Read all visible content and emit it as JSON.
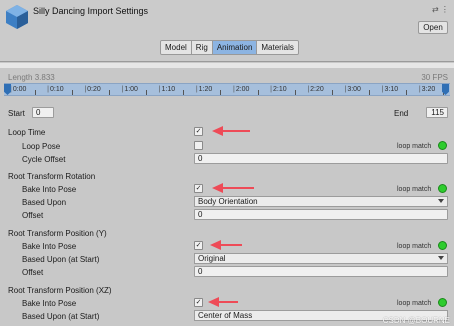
{
  "header": {
    "title": "Silly Dancing Import Settings",
    "icons": "⇄ ⋮",
    "open_label": "Open",
    "tabs": [
      "Model",
      "Rig",
      "Animation",
      "Materials"
    ],
    "active_tab": "Animation"
  },
  "timeline": {
    "length_label": "Length",
    "length_value": "3.833",
    "fps": "30 FPS",
    "ticks": [
      "0:00",
      "0:10",
      "0:20",
      "1:00",
      "1:10",
      "1:20",
      "2:00",
      "2:10",
      "2:20",
      "3:00",
      "3:10",
      "3:20"
    ]
  },
  "range": {
    "start_label": "Start",
    "start_value": "0",
    "end_label": "End",
    "end_value": "115"
  },
  "loop": {
    "loop_time_label": "Loop Time",
    "loop_time_checked": "✓",
    "loop_pose_label": "Loop Pose",
    "loop_match_label": "loop match",
    "cycle_offset_label": "Cycle Offset",
    "cycle_offset_value": "0"
  },
  "rotation": {
    "section_label": "Root Transform Rotation",
    "bake_label": "Bake Into Pose",
    "bake_checked": "✓",
    "loop_match_label": "loop match",
    "based_upon_label": "Based Upon",
    "based_upon_value": "Body Orientation",
    "offset_label": "Offset",
    "offset_value": "0"
  },
  "position_y": {
    "section_label": "Root Transform Position (Y)",
    "bake_label": "Bake Into Pose",
    "bake_checked": "✓",
    "loop_match_label": "loop match",
    "based_upon_label": "Based Upon (at Start)",
    "based_upon_value": "Original",
    "offset_label": "Offset",
    "offset_value": "0"
  },
  "position_xz": {
    "section_label": "Root Transform Position (XZ)",
    "bake_label": "Bake Into Pose",
    "bake_checked": "✓",
    "loop_match_label": "loop match",
    "based_upon_label": "Based Upon (at Start)",
    "based_upon_value": "Center of Mass"
  },
  "watermark": "CSDN @BOURNE",
  "colors": {
    "loop_match": "#2ecc2e",
    "arrow": "#ee4b57",
    "active_tab": "#8cb4e2"
  }
}
